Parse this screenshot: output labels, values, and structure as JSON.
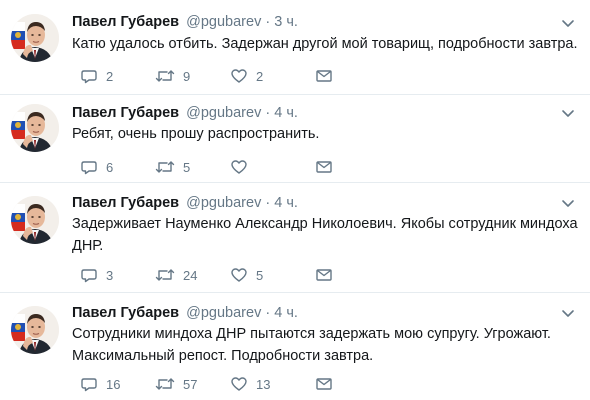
{
  "tweets": [
    {
      "author_name": "Павел Губарев",
      "handle": "@pgubarev",
      "separator": "·",
      "time": "3 ч.",
      "text_lines": [
        "Катю удалось отбить. Задержан другой мой товарищ, подробности завтра."
      ],
      "replies": "2",
      "retweets": "9",
      "likes": "2",
      "reply_icon": "reply-icon",
      "retweet_icon": "retweet-icon",
      "like_icon": "heart-icon",
      "dm_icon": "envelope-icon"
    },
    {
      "author_name": "Павел Губарев",
      "handle": "@pgubarev",
      "separator": "·",
      "time": "4 ч.",
      "text_lines": [
        "Ребят, очень прошу распространить."
      ],
      "replies": "6",
      "retweets": "5",
      "likes": "",
      "reply_icon": "reply-icon",
      "retweet_icon": "retweet-icon",
      "like_icon": "heart-icon",
      "dm_icon": "envelope-icon"
    },
    {
      "author_name": "Павел Губарев",
      "handle": "@pgubarev",
      "separator": "·",
      "time": "4 ч.",
      "text_lines": [
        "Задерживает Науменко Александр Николоевич. Якобы сотрудник миндоха",
        "ДНР."
      ],
      "replies": "3",
      "retweets": "24",
      "likes": "5",
      "reply_icon": "reply-icon",
      "retweet_icon": "retweet-icon",
      "like_icon": "heart-icon",
      "dm_icon": "envelope-icon"
    },
    {
      "author_name": "Павел Губарев",
      "handle": "@pgubarev",
      "separator": "·",
      "time": "4 ч.",
      "text_lines": [
        "Сотрудники миндоха ДНР пытаются задержать мою супругу. Угрожают.",
        "Максимальный репост. Подробности завтра."
      ],
      "replies": "16",
      "retweets": "57",
      "likes": "13",
      "reply_icon": "reply-icon",
      "retweet_icon": "retweet-icon",
      "like_icon": "heart-icon",
      "dm_icon": "envelope-icon"
    }
  ],
  "colors": {
    "text": "#14171a",
    "secondary": "#657786",
    "divider": "#e6ecf0",
    "flag_white": "#ffffff",
    "flag_blue": "#1f4fb4",
    "flag_red": "#d52b1e",
    "emblem_gold": "#e0b43a"
  }
}
